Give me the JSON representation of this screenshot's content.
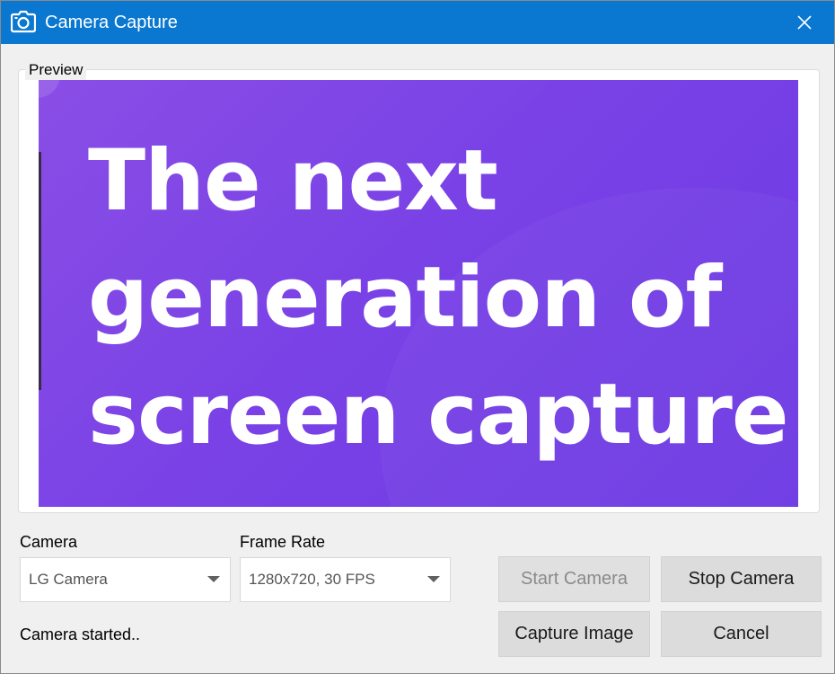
{
  "window": {
    "title": "Camera Capture",
    "app_icon": "camera-icon",
    "close_icon": "close-icon",
    "titlebar_color": "#0a78d0"
  },
  "preview": {
    "label": "Preview",
    "lines": [
      "The next",
      "generation of",
      "screen capture"
    ],
    "background_color": "#7a42e6"
  },
  "camera": {
    "label": "Camera",
    "value": "LG Camera"
  },
  "frame_rate": {
    "label": "Frame Rate",
    "value": "1280x720, 30 FPS"
  },
  "status_text": "Camera started..",
  "buttons": {
    "start_camera": "Start Camera",
    "stop_camera": "Stop Camera",
    "capture_image": "Capture Image",
    "cancel": "Cancel"
  }
}
